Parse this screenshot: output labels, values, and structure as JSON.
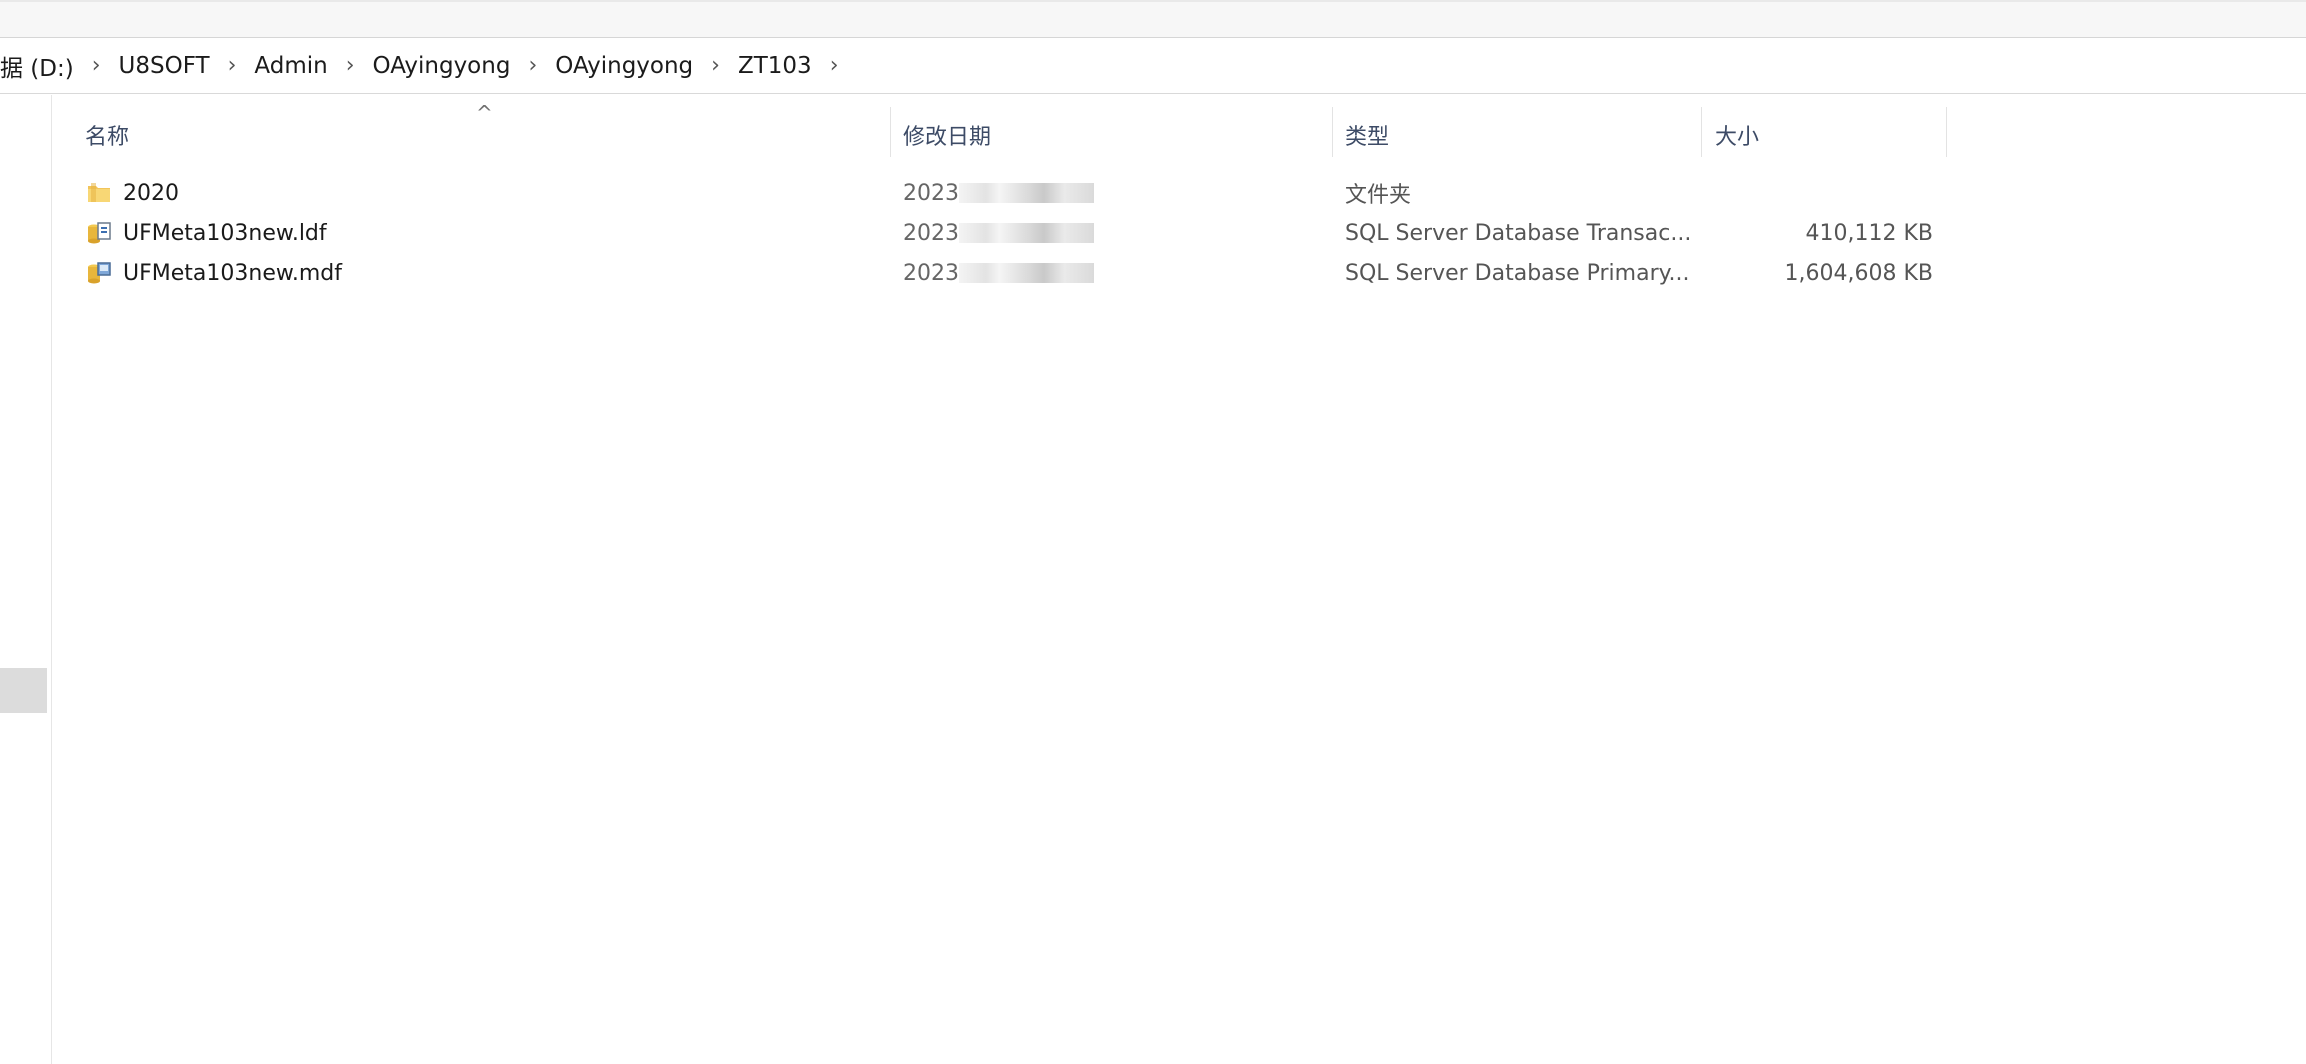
{
  "breadcrumb": [
    {
      "label": "据 (D:)"
    },
    {
      "label": "U8SOFT"
    },
    {
      "label": "Admin"
    },
    {
      "label": "OAyingyong"
    },
    {
      "label": "OAyingyong"
    },
    {
      "label": "ZT103"
    }
  ],
  "breadcrumb_separator": "›",
  "columns": {
    "name": "名称",
    "date": "修改日期",
    "type": "类型",
    "size": "大小"
  },
  "sort_indicator": "^",
  "files": [
    {
      "name": "2020",
      "date": "2023",
      "type": "文件夹",
      "size": "",
      "icon": "folder-icon"
    },
    {
      "name": "UFMeta103new.ldf",
      "date": "2023",
      "type": "SQL Server Database Transac...",
      "size": "410,112 KB",
      "icon": "sql-database-file-icon"
    },
    {
      "name": "UFMeta103new.mdf",
      "date": "2023",
      "type": "SQL Server Database Primary...",
      "size": "1,604,608 KB",
      "icon": "sql-database-file-icon"
    }
  ],
  "colors": {
    "header_text": "#3d4b66",
    "folder": "#f2c45a",
    "selection_hover": "#e5f3ff"
  }
}
